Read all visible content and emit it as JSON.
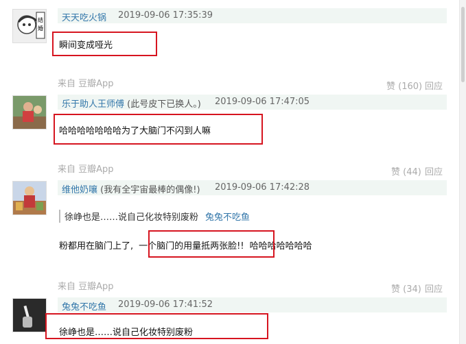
{
  "comments": [
    {
      "author": "天天吃火锅",
      "author_note": "",
      "time": "2019-09-06 17:35:39",
      "text": "瞬间变成哑光"
    },
    {
      "source": "来自 豆瓣App",
      "votes": "赞 (160)",
      "reply": "回应",
      "author": "乐于助人王师傅",
      "author_note": "(此号皮下已换人。)",
      "time": "2019-09-06 17:47:05",
      "text": "哈哈哈哈哈哈哈为了大脑门不闪到人嘛"
    },
    {
      "source": "来自 豆瓣App",
      "votes": "赞 (44)",
      "reply": "回应",
      "author": "维他奶嚷",
      "author_note": "(我有全宇宙最棒的偶像!)",
      "time": "2019-09-06 17:42:28",
      "quote_text": "徐峥也是……说自己化妆特别废粉",
      "quote_author": "兔兔不吃鱼",
      "text_a": "粉都用在脑门上了,",
      "text_b": "一个脑门的用量抵两张脸!!",
      "text_c": "哈哈哈哈哈哈哈"
    },
    {
      "source": "来自 豆瓣App",
      "votes": "赞 (34)",
      "reply": "回应",
      "author": "兔兔不吃鱼",
      "author_note": "",
      "time": "2019-09-06 17:41:52",
      "text": "徐峥也是……说自己化妆特别废粉"
    }
  ],
  "colors": {
    "highlight": "#d6141f",
    "link": "#3377aa",
    "header_bg": "#f0f6f3"
  }
}
